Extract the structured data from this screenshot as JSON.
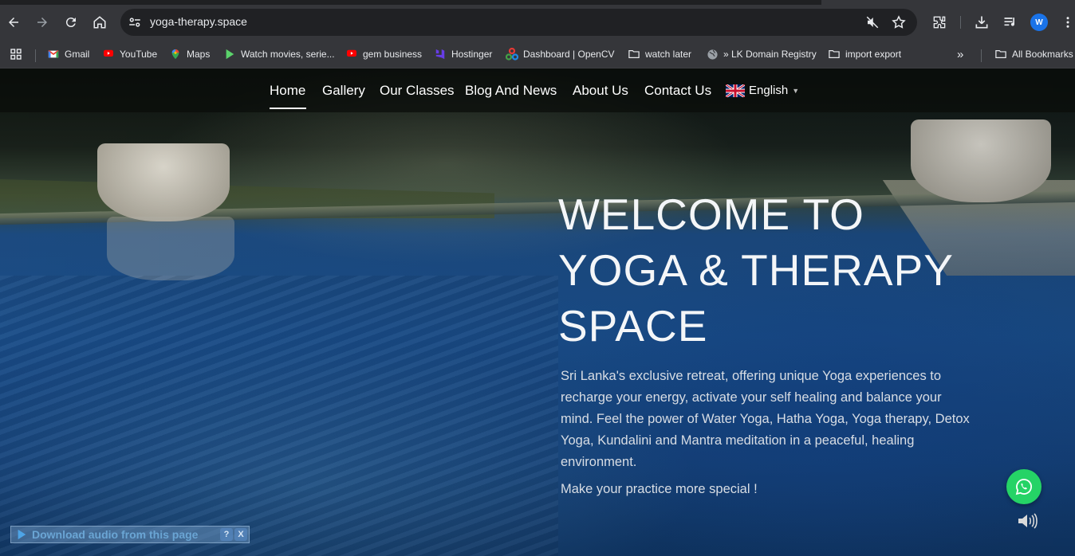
{
  "browser": {
    "url": "yoga-therapy.space",
    "profile_initial": "W",
    "bookmarks": [
      {
        "label": "Gmail",
        "icon": "gmail-icon"
      },
      {
        "label": "YouTube",
        "icon": "youtube-icon"
      },
      {
        "label": "Maps",
        "icon": "maps-icon"
      },
      {
        "label": "Watch movies, serie...",
        "icon": "play-icon"
      },
      {
        "label": "gem business",
        "icon": "youtube-icon"
      },
      {
        "label": "Hostinger",
        "icon": "hostinger-icon"
      },
      {
        "label": "Dashboard | OpenCV",
        "icon": "opencv-icon"
      },
      {
        "label": "watch later",
        "icon": "folder-icon"
      },
      {
        "label": "» LK Domain Registry",
        "icon": "globe-icon"
      },
      {
        "label": "import export",
        "icon": "folder-icon"
      }
    ],
    "overflow": "»",
    "all_bookmarks": "All Bookmarks"
  },
  "nav": {
    "items": [
      "Home",
      "Gallery",
      "Our Classes",
      "Blog And News",
      "About Us",
      "Contact Us"
    ],
    "active": "Home",
    "language": "English",
    "language_caret": "▼"
  },
  "hero": {
    "title_line1": "WELCOME TO",
    "title_line2": "YOGA & THERAPY",
    "title_line3": "SPACE",
    "description": "Sri Lanka's exclusive retreat, offering unique Yoga experiences to recharge your energy, activate your self healing and balance your mind. Feel the power of Water Yoga, Hatha Yoga, Yoga therapy, Detox Yoga, Kundalini and Mantra meditation in a peaceful, healing environment.",
    "cta": "Make your practice more special !"
  },
  "widgets": {
    "audio_label": "Download audio from this page",
    "audio_help": "?",
    "audio_close": "X"
  },
  "colors": {
    "whatsapp": "#25d366",
    "profile": "#1a73e8",
    "chrome_toolbar": "#35363a"
  }
}
